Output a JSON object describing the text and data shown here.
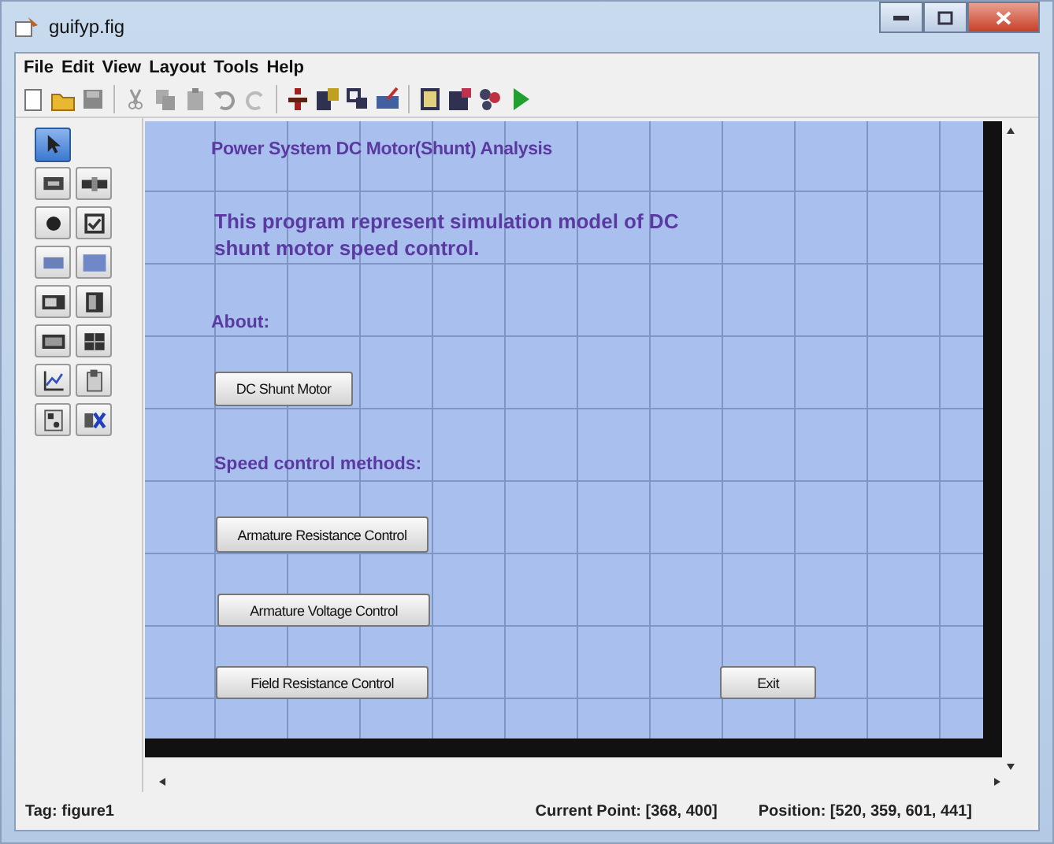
{
  "window": {
    "title": "guifyp.fig"
  },
  "menu": [
    "File",
    "Edit",
    "View",
    "Layout",
    "Tools",
    "Help"
  ],
  "palette": [
    {
      "selected": true
    },
    {
      "selected": false
    },
    {
      "selected": false
    },
    {
      "selected": false
    },
    {
      "selected": false
    },
    {
      "selected": false
    },
    {
      "selected": false
    },
    {
      "selected": false
    },
    {
      "selected": false
    },
    {
      "selected": false
    },
    {
      "selected": false
    },
    {
      "selected": false
    },
    {
      "selected": false
    },
    {
      "selected": false
    },
    {
      "selected": false
    }
  ],
  "canvas": {
    "components": [
      {
        "kind": "title",
        "text": "Power System DC Motor(Shunt) Analysis"
      },
      {
        "kind": "text",
        "text": "This program represent simulation model of DC shunt motor speed control."
      },
      {
        "kind": "heading",
        "text": "About:"
      },
      {
        "kind": "button",
        "text": "DC Shunt Motor"
      },
      {
        "kind": "heading",
        "text": "Speed control methods:"
      },
      {
        "kind": "button",
        "text": "Armature Resistance Control"
      },
      {
        "kind": "button",
        "text": "Armature Voltage Control"
      },
      {
        "kind": "button",
        "text": "Field Resistance Control"
      },
      {
        "kind": "button",
        "text": "Exit"
      }
    ]
  },
  "status_bar": {
    "tag": "Tag: figure1",
    "current_point": "Current Point:  [368, 400]",
    "position": "Position: [520, 359, 601, 441]"
  }
}
